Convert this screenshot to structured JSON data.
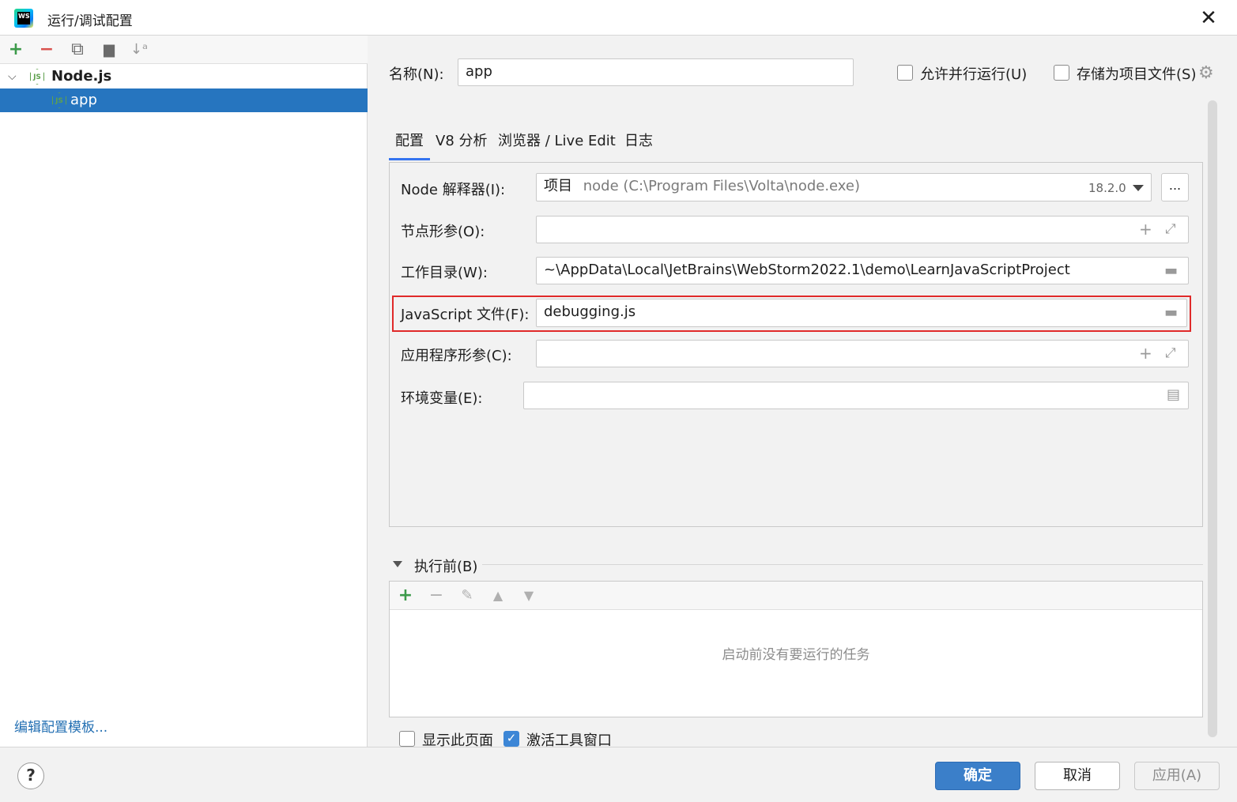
{
  "window": {
    "title": "运行/调试配置",
    "logo_text": "WS"
  },
  "left": {
    "toolbar": {
      "add": "+",
      "remove": "−",
      "copy": "⧉",
      "new_folder": "▆",
      "sort": "↓ᵃ"
    },
    "tree": [
      {
        "label": "Node.js",
        "icon": "JS"
      },
      {
        "label": "app",
        "icon": "JS"
      }
    ],
    "edit_templates": "编辑配置模板..."
  },
  "header": {
    "name_label": "名称(N):",
    "name_value": "app",
    "allow_parallel": "允许并行运行(U)",
    "store_as_project": "存储为项目文件(S)"
  },
  "tabs": [
    {
      "label": "配置"
    },
    {
      "label": "V8 分析"
    },
    {
      "label": "浏览器 / Live Edit"
    },
    {
      "label": "日志"
    }
  ],
  "config": {
    "node_interpreter_label": "Node 解释器(I):",
    "node_interpreter_kind": "项目",
    "node_interpreter_path": "node (C:\\Program Files\\Volta\\node.exe)",
    "node_version": "18.2.0",
    "browse_label": "...",
    "node_params_label": "节点形参(O):",
    "node_params_value": "",
    "workdir_label": "工作目录(W):",
    "workdir_value": "~\\AppData\\Local\\JetBrains\\WebStorm2022.1\\demo\\LearnJavaScriptProject",
    "jsfile_label": "JavaScript 文件(F):",
    "jsfile_value": "debugging.js",
    "app_params_label": "应用程序形参(C):",
    "app_params_value": "",
    "env_label": "环境变量(E):",
    "env_value": ""
  },
  "before_launch": {
    "title": "执行前(B)",
    "empty_text": "启动前没有要运行的任务"
  },
  "options": {
    "show_page": "显示此页面",
    "activate_tool_window": "激活工具窗口"
  },
  "buttons": {
    "help": "?",
    "ok": "确定",
    "cancel": "取消",
    "apply": "应用(A)"
  },
  "colors": {
    "accent": "#2675bf",
    "highlight": "#e02a2a",
    "node_green": "#5fa04e",
    "add_green": "#3c9a4a",
    "remove_red": "#d9534f"
  }
}
